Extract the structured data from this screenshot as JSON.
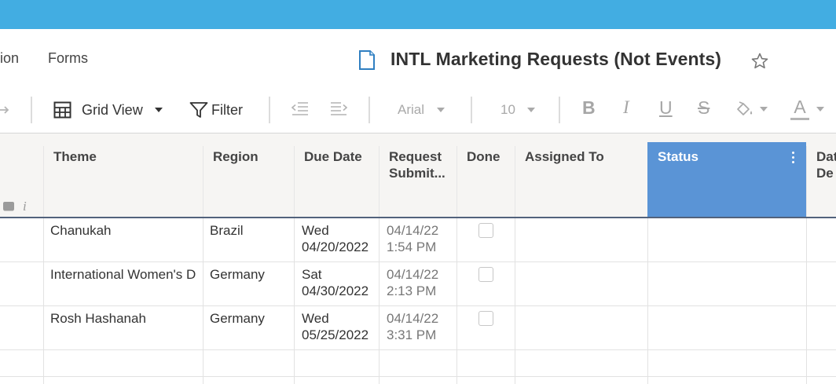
{
  "nav": {
    "partial_left": "ion",
    "forms": "Forms"
  },
  "sheet": {
    "title": "INTL Marketing Requests (Not Events)"
  },
  "toolbar": {
    "view": "Grid View",
    "filter": "Filter",
    "font": "Arial",
    "font_size": "10",
    "bold": "B",
    "italic": "I",
    "underline": "U",
    "strike": "S",
    "text_color": "A"
  },
  "columns": {
    "theme": "Theme",
    "region": "Region",
    "due_date_line1": "Due Date",
    "request_line1": "Request",
    "request_line2": "Submit...",
    "done": "Done",
    "assigned": "Assigned To",
    "status": "Status",
    "partial_line1": "Dat",
    "partial_line2": "De"
  },
  "rows": [
    {
      "theme": "Chanukah",
      "region": "Brazil",
      "due_day": "Wed",
      "due_date": "04/20/2022",
      "submitted_date": "04/14/22",
      "submitted_time": "1:54 PM",
      "done": false
    },
    {
      "theme": "International Women's Day",
      "region": "Germany",
      "due_day": "Sat",
      "due_date": "04/30/2022",
      "submitted_date": "04/14/22",
      "submitted_time": "2:13 PM",
      "done": false
    },
    {
      "theme": "Rosh Hashanah",
      "region": "Germany",
      "due_day": "Wed",
      "due_date": "05/25/2022",
      "submitted_date": "04/14/22",
      "submitted_time": "3:31 PM",
      "done": false
    }
  ],
  "colors": {
    "topbar": "#42ade2",
    "status_header": "#5a94d6",
    "header_underline": "#52627c"
  }
}
